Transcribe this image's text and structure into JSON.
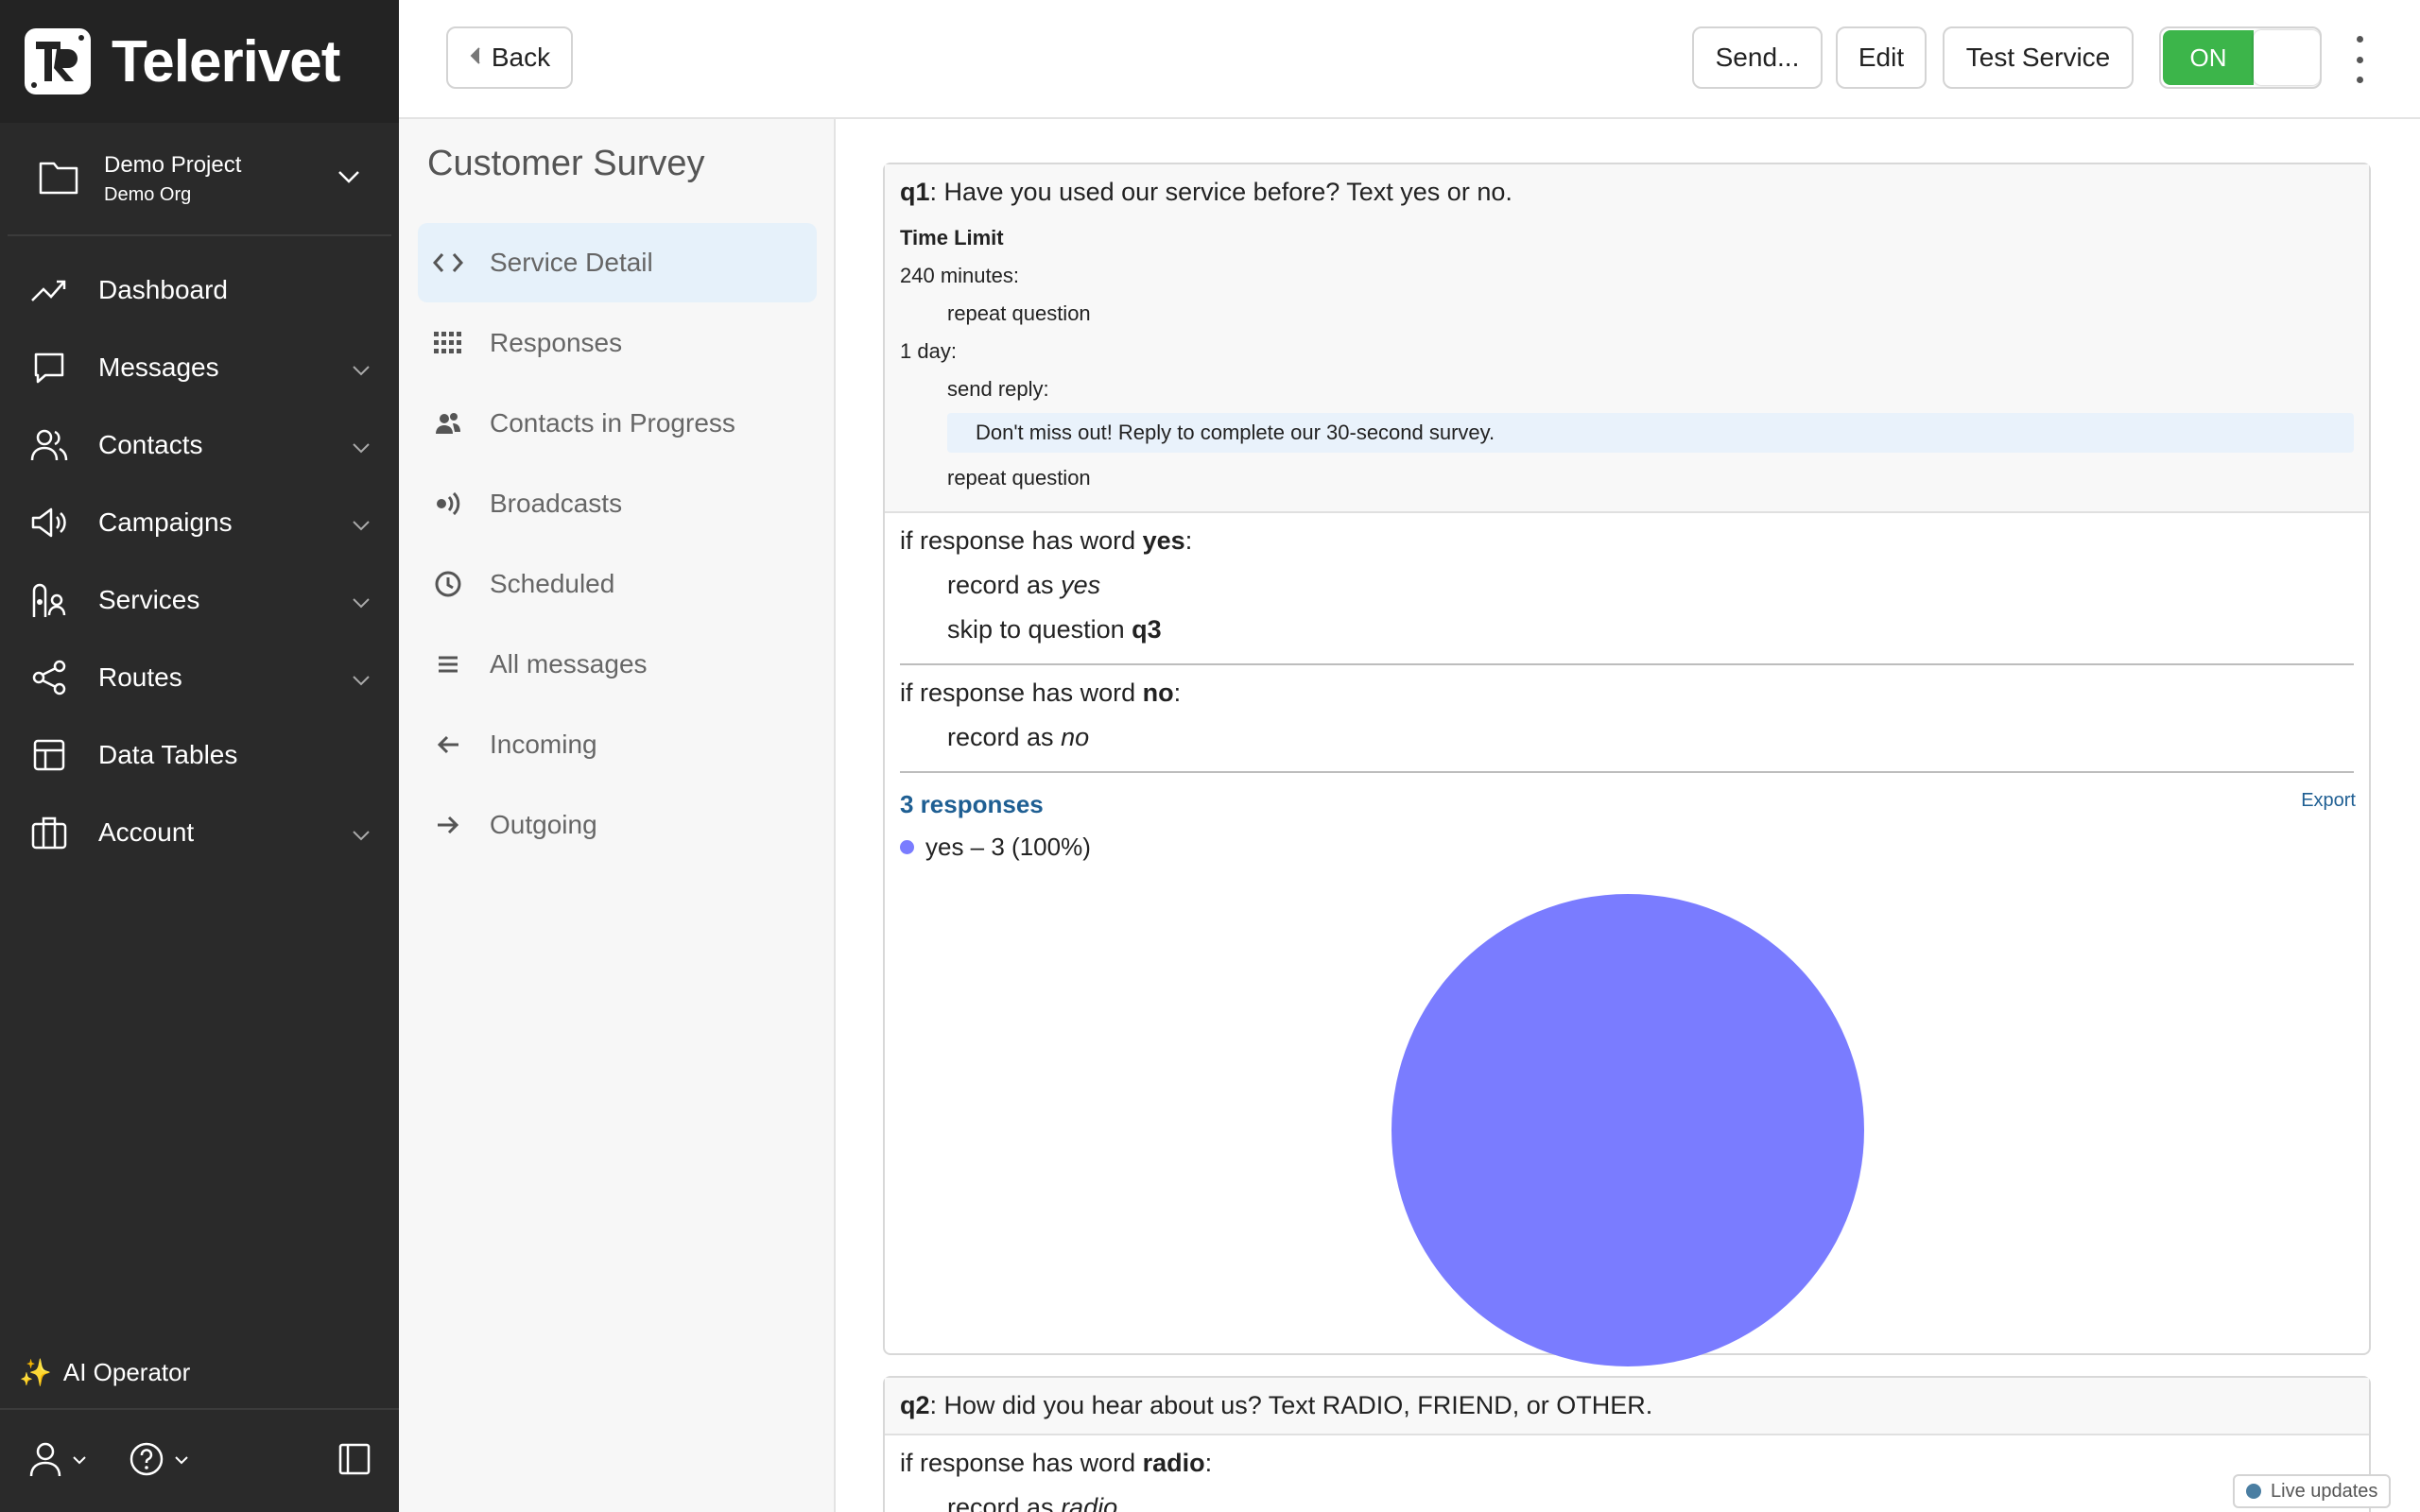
{
  "brand": {
    "name": "Telerivet"
  },
  "project": {
    "name": "Demo Project",
    "org": "Demo Org"
  },
  "nav": {
    "items": [
      {
        "label": "Dashboard",
        "icon": "trend-icon",
        "expandable": false
      },
      {
        "label": "Messages",
        "icon": "message-icon",
        "expandable": true
      },
      {
        "label": "Contacts",
        "icon": "contacts-icon",
        "expandable": true
      },
      {
        "label": "Campaigns",
        "icon": "megaphone-icon",
        "expandable": true
      },
      {
        "label": "Services",
        "icon": "services-icon",
        "expandable": true
      },
      {
        "label": "Routes",
        "icon": "share-icon",
        "expandable": true
      },
      {
        "label": "Data Tables",
        "icon": "table-icon",
        "expandable": false
      },
      {
        "label": "Account",
        "icon": "briefcase-icon",
        "expandable": true
      }
    ],
    "ai_operator": "AI Operator"
  },
  "toolbar": {
    "back": "Back",
    "send": "Send...",
    "edit": "Edit",
    "test": "Test Service",
    "toggle": "ON"
  },
  "service": {
    "title": "Customer Survey",
    "menu": [
      {
        "label": "Service Detail",
        "icon": "code-icon",
        "active": true
      },
      {
        "label": "Responses",
        "icon": "grid-icon",
        "active": false
      },
      {
        "label": "Contacts in Progress",
        "icon": "users-icon",
        "active": false
      },
      {
        "label": "Broadcasts",
        "icon": "broadcast-icon",
        "active": false
      },
      {
        "label": "Scheduled",
        "icon": "clock-icon",
        "active": false
      },
      {
        "label": "All messages",
        "icon": "list-icon",
        "active": false
      },
      {
        "label": "Incoming",
        "icon": "arrow-left-icon",
        "active": false
      },
      {
        "label": "Outgoing",
        "icon": "arrow-right-icon",
        "active": false
      }
    ]
  },
  "q1": {
    "id": "q1",
    "text": ": Have you used our service before? Text yes or no.",
    "time_limit_label": "Time Limit",
    "limit1": "240 minutes:",
    "limit1_action": "repeat question",
    "limit2": "1 day:",
    "limit2_action": "send reply:",
    "limit2_reply": "Don't miss out! Reply to complete our 30-second survey.",
    "limit2_action2": "repeat question",
    "rule1_prefix": "if response has word ",
    "rule1_word": "yes",
    "rule1_suffix": ":",
    "rule1_record_prefix": "record as ",
    "rule1_record": "yes",
    "rule1_skip_prefix": "skip to question ",
    "rule1_skip": "q3",
    "rule2_prefix": "if response has word ",
    "rule2_word": "no",
    "rule2_suffix": ":",
    "rule2_record_prefix": "record as ",
    "rule2_record": "no",
    "responses": "3 responses",
    "export": "Export"
  },
  "chart_data": {
    "type": "pie",
    "slices": [
      {
        "label": "yes – 3 (100%)",
        "value": 3,
        "color": "#7a7cff"
      }
    ]
  },
  "q2": {
    "id": "q2",
    "text": ": How did you hear about us? Text RADIO, FRIEND, or OTHER.",
    "rule1_prefix": "if response has word ",
    "rule1_word": "radio",
    "rule1_suffix": ":",
    "rule1_record_prefix": "record as ",
    "rule1_record": "radio"
  },
  "live_updates": "Live updates"
}
